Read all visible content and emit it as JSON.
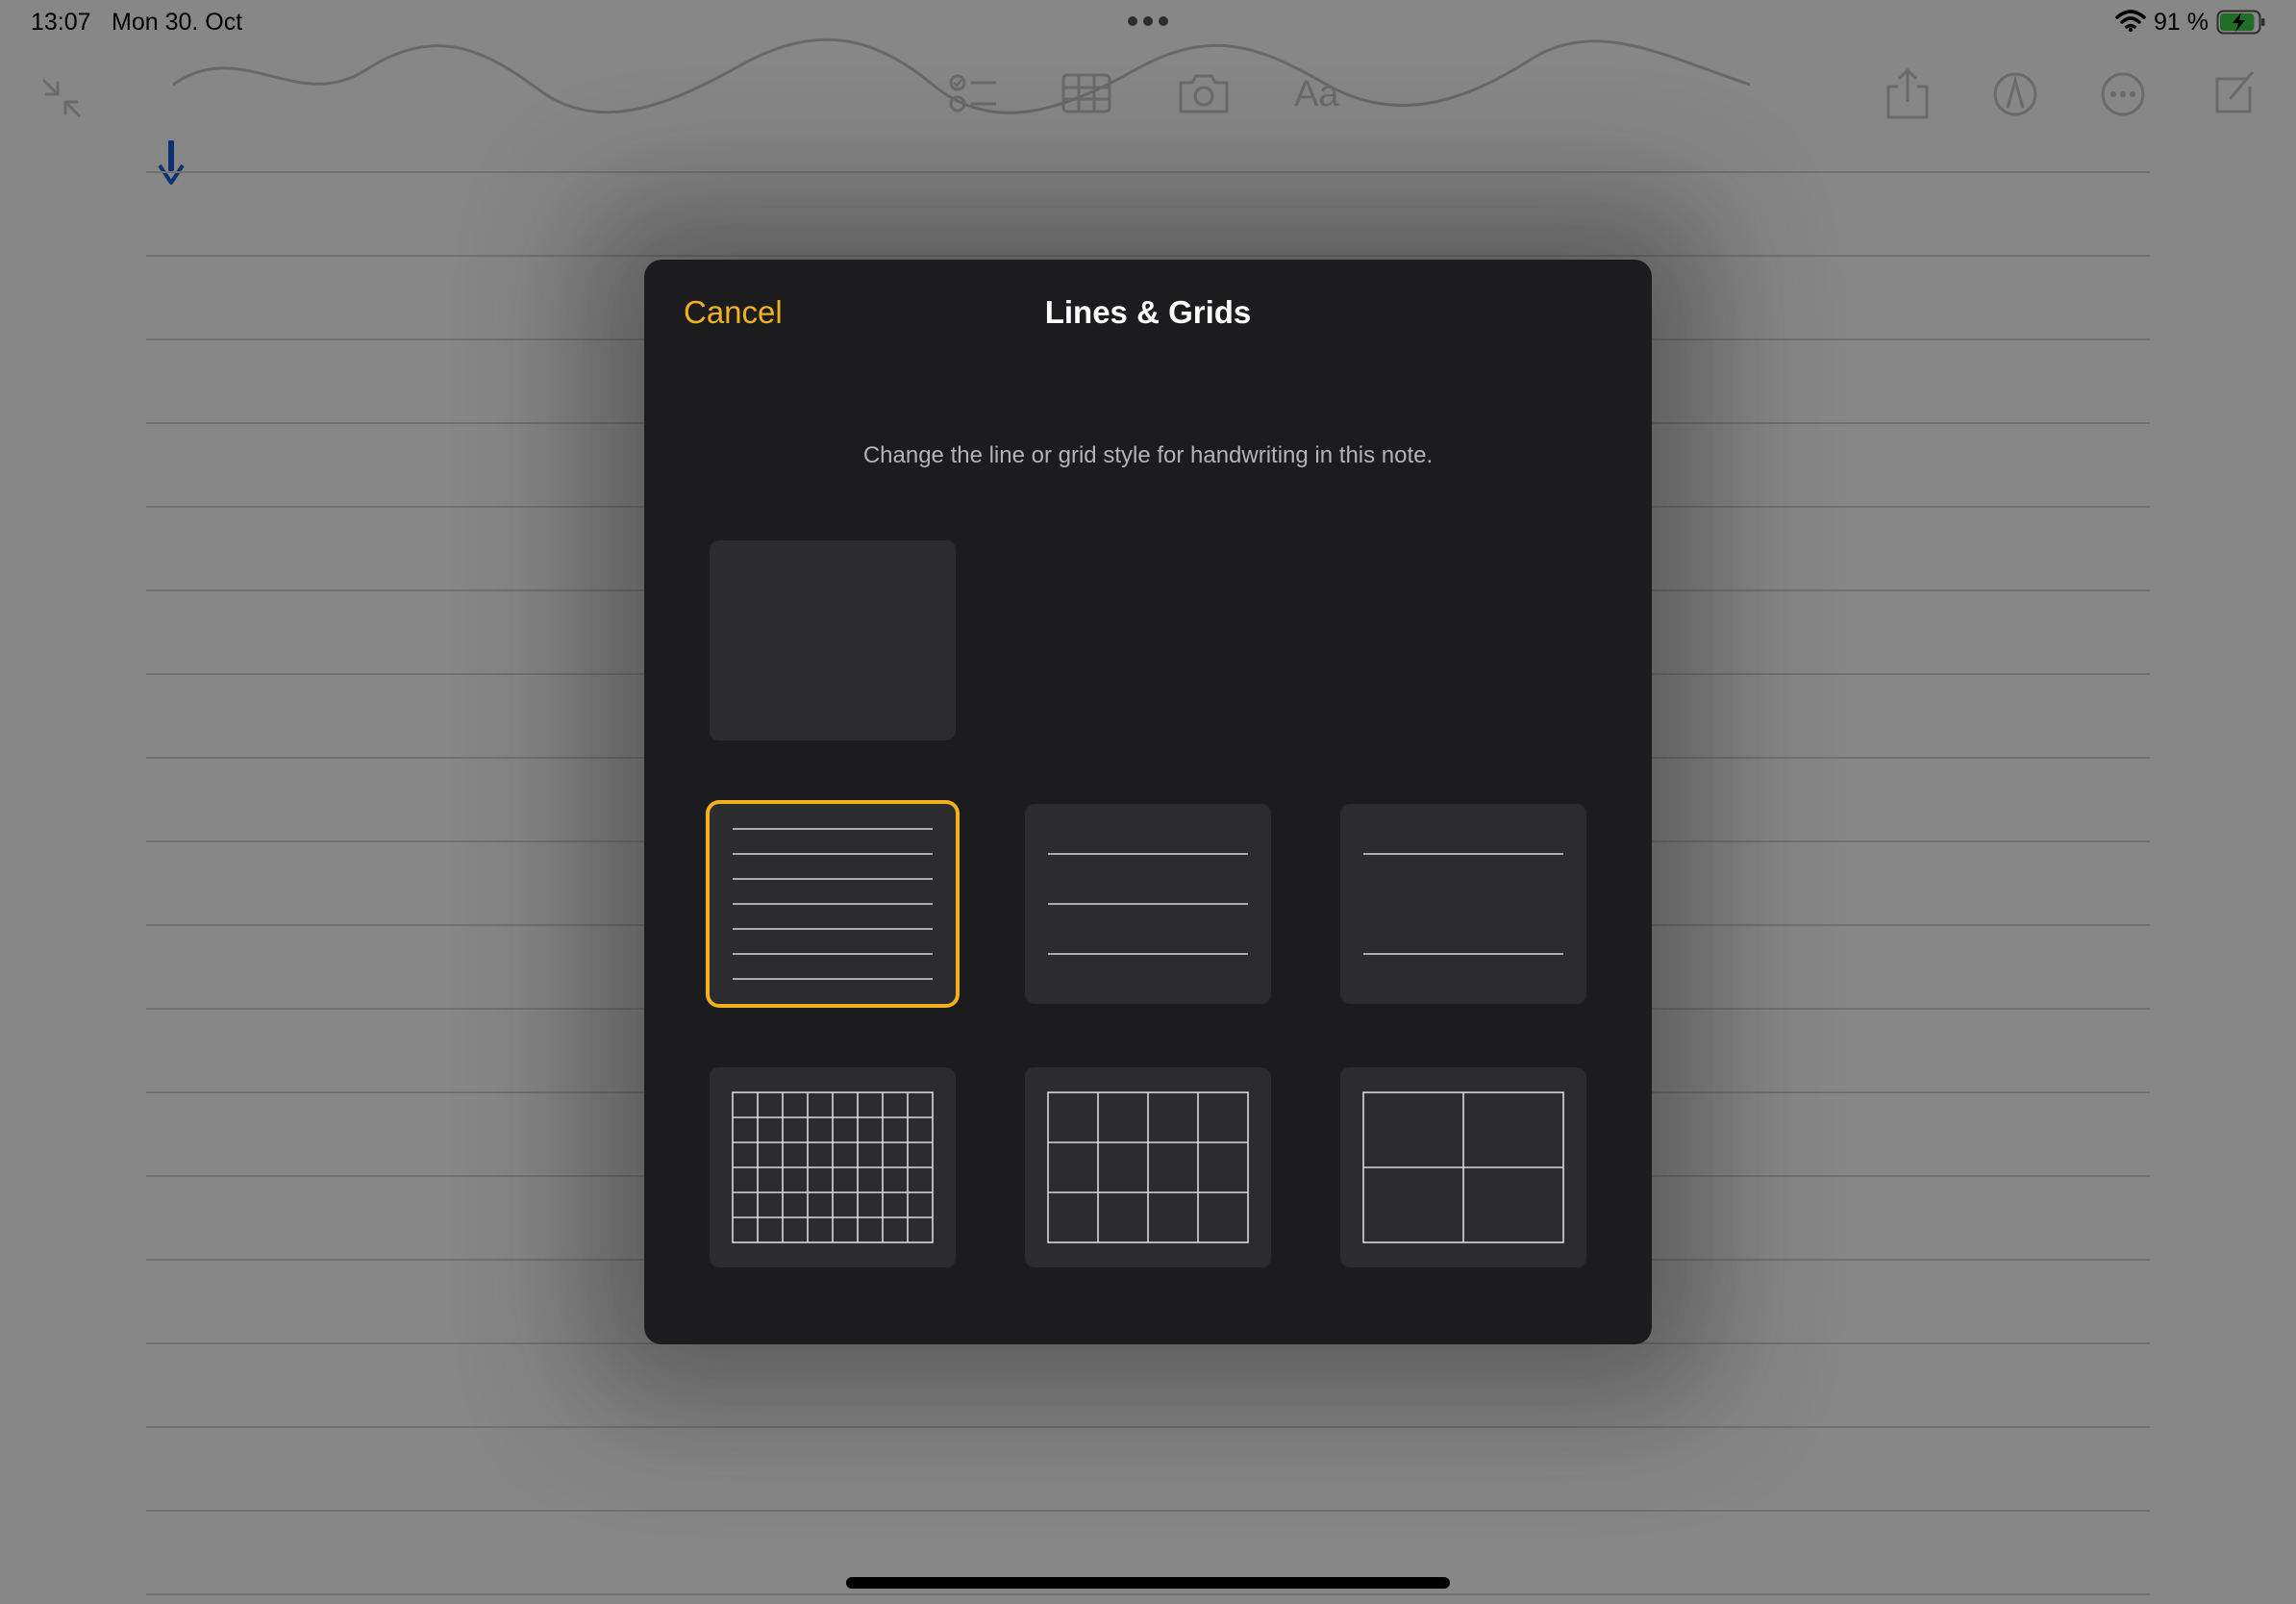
{
  "status_bar": {
    "time": "13:07",
    "date": "Mon 30. Oct",
    "battery_percent": "91 %",
    "battery_level": 0.91,
    "icons": [
      "multitasking-dots-icon",
      "wifi-icon",
      "battery-charging-icon"
    ]
  },
  "toolbar": {
    "left_icons": [
      "collapse-icon"
    ],
    "center_icons": [
      "checklist-icon",
      "table-icon",
      "camera-icon",
      "text-format-icon"
    ],
    "center_format_label": "Aa",
    "right_icons": [
      "share-icon",
      "markup-icon",
      "more-icon",
      "compose-icon"
    ]
  },
  "dialog": {
    "cancel_label": "Cancel",
    "title": "Lines & Grids",
    "description": "Change the line or grid style for handwriting in this note.",
    "accent_color": "#f0b11d",
    "options": [
      {
        "id": "none",
        "style": "blank",
        "selected": false
      },
      {
        "id": "lines-narrow",
        "style": "lines",
        "selected": true
      },
      {
        "id": "lines-medium",
        "style": "lines",
        "selected": false
      },
      {
        "id": "lines-wide",
        "style": "lines",
        "selected": false
      },
      {
        "id": "grid-small",
        "style": "grid",
        "selected": false
      },
      {
        "id": "grid-medium",
        "style": "grid",
        "selected": false
      },
      {
        "id": "grid-large",
        "style": "grid",
        "selected": false
      }
    ]
  }
}
